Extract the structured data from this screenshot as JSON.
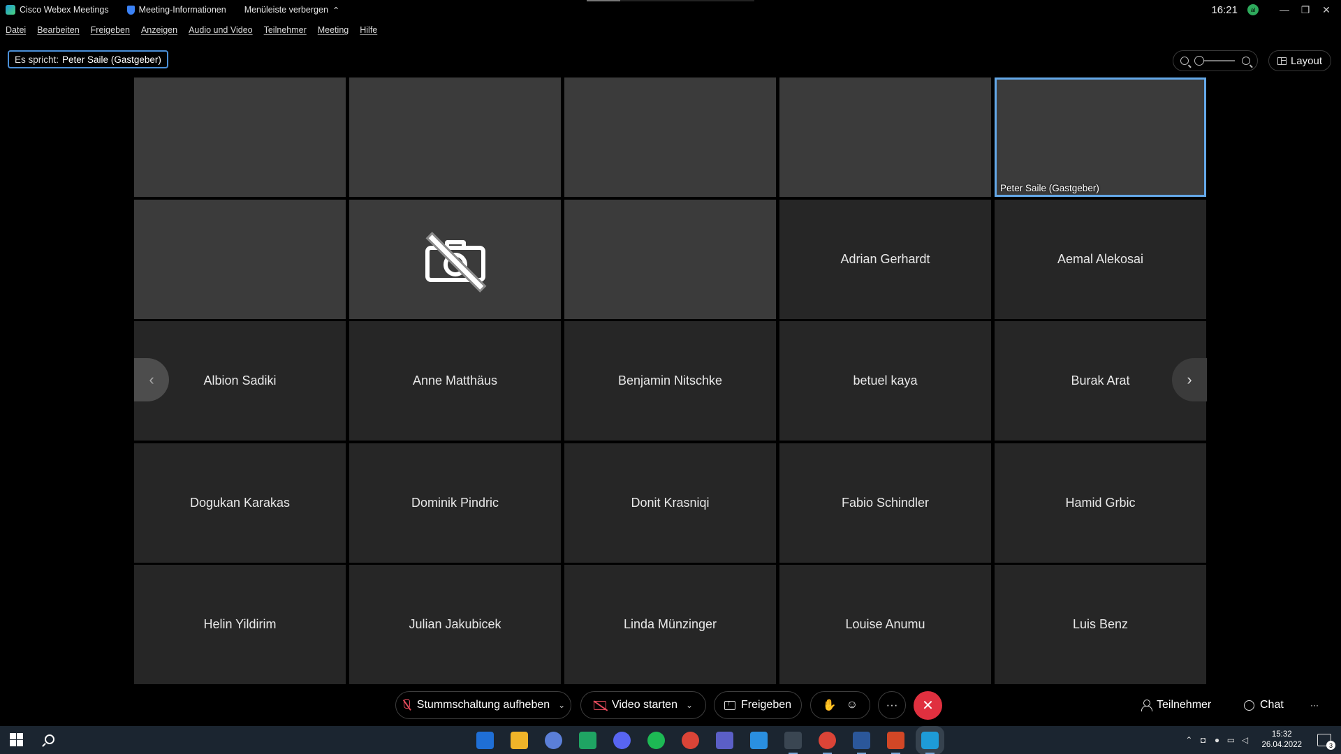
{
  "titlebar": {
    "app_name": "Cisco Webex Meetings",
    "meeting_info": "Meeting-Informationen",
    "hide_menu": "Menüleiste verbergen",
    "time": "16:21",
    "avatar_initials": "al"
  },
  "menu": [
    {
      "label": "Datei"
    },
    {
      "label": "Bearbeiten"
    },
    {
      "label": "Freigeben"
    },
    {
      "label": "Anzeigen"
    },
    {
      "label": "Audio und Video"
    },
    {
      "label": "Teilnehmer"
    },
    {
      "label": "Meeting"
    },
    {
      "label": "Hilfe"
    }
  ],
  "speaking": {
    "prefix": "Es spricht:",
    "name": "Peter Saile (Gastgeber)"
  },
  "layout_button": "Layout",
  "video_tiles": [
    {
      "caption": "",
      "icon": "video-feed"
    },
    {
      "caption": "",
      "icon": "video-feed"
    },
    {
      "caption": "",
      "icon": "video-feed"
    },
    {
      "caption": "",
      "icon": "video-feed"
    },
    {
      "caption": "Peter Saile (Gastgeber)",
      "icon": "video-feed",
      "active_speaker": true
    },
    {
      "caption": "",
      "icon": "video-feed"
    },
    {
      "caption": "",
      "icon": "camera-off-icon"
    },
    {
      "caption": "",
      "icon": "video-feed"
    }
  ],
  "participants": [
    "Adrian Gerhardt",
    "Aemal Alekosai",
    "Albion Sadiki",
    "Anne Matthäus",
    "Benjamin Nitschke",
    "betuel kaya",
    "Burak Arat",
    "Dogukan Karakas",
    "Dominik Pindric",
    "Donit Krasniqi",
    "Fabio Schindler",
    "Hamid Grbic",
    "Helin Yildirim",
    "Julian Jakubicek",
    "Linda Münzinger",
    "Louise Anumu",
    "Luis Benz"
  ],
  "controls": {
    "unmute": "Stummschaltung aufheben",
    "start_video": "Video starten",
    "share": "Freigeben",
    "participants": "Teilnehmer",
    "chat": "Chat",
    "more": "···",
    "more_right": "···"
  },
  "taskbar": {
    "time": "15:32",
    "date": "26.04.2022",
    "notifications": "3",
    "apps": [
      {
        "name": "mail-icon",
        "color": "#1f6fd6"
      },
      {
        "name": "file-explorer-icon",
        "color": "#f0b429"
      },
      {
        "name": "cortana-icon",
        "color": "#5b7fd8"
      },
      {
        "name": "google-drive-icon",
        "color": "#1fa463"
      },
      {
        "name": "discord-icon",
        "color": "#5865f2"
      },
      {
        "name": "spotify-icon",
        "color": "#1db954"
      },
      {
        "name": "chrome-icon",
        "color": "#db4437"
      },
      {
        "name": "teams-icon",
        "color": "#5b5fc7"
      },
      {
        "name": "vscode-icon",
        "color": "#2a8fe0"
      },
      {
        "name": "react-icon",
        "color": "#3a4652"
      },
      {
        "name": "chrome-profile-icon",
        "color": "#db4437"
      },
      {
        "name": "word-icon",
        "color": "#2b579a"
      },
      {
        "name": "powerpoint-icon",
        "color": "#d24726"
      },
      {
        "name": "webex-icon",
        "color": "#1e9bd7"
      }
    ]
  },
  "colors": {
    "active_speaker_border": "#64a8e8",
    "hangup": "#e0303f",
    "muted_icon": "#e0495a"
  }
}
